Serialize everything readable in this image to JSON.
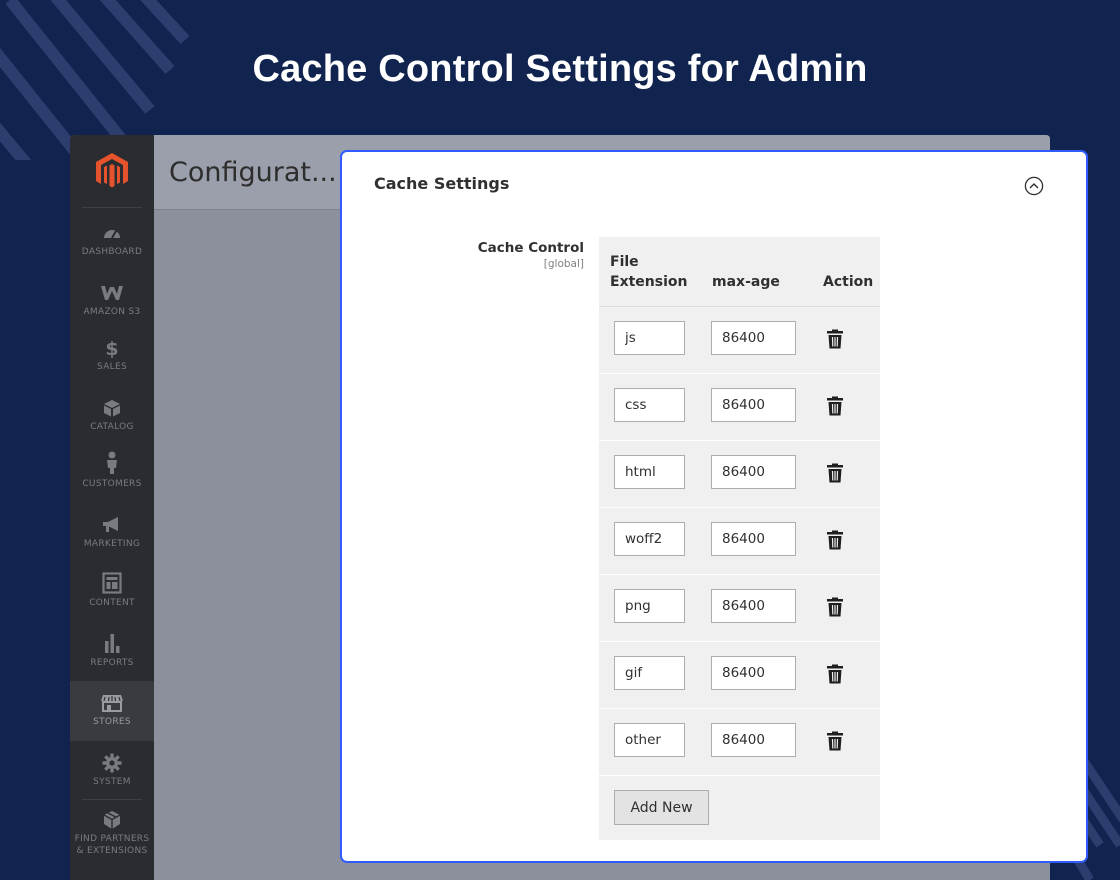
{
  "hero": {
    "title": "Cache Control Settings for Admin"
  },
  "admin": {
    "page_title": "Configurat..."
  },
  "sidebar": {
    "items": [
      {
        "label": "DASHBOARD",
        "icon": "dashboard-icon"
      },
      {
        "label": "AMAZON S3",
        "icon": "amazon-s3-icon"
      },
      {
        "label": "SALES",
        "icon": "dollar-icon"
      },
      {
        "label": "CATALOG",
        "icon": "box-icon"
      },
      {
        "label": "CUSTOMERS",
        "icon": "person-icon"
      },
      {
        "label": "MARKETING",
        "icon": "megaphone-icon"
      },
      {
        "label": "CONTENT",
        "icon": "layout-icon"
      },
      {
        "label": "REPORTS",
        "icon": "bar-chart-icon"
      },
      {
        "label": "STORES",
        "icon": "store-icon"
      },
      {
        "label": "SYSTEM",
        "icon": "gear-icon"
      },
      {
        "label": "FIND PARTNERS",
        "label2": "& EXTENSIONS",
        "icon": "extensions-icon"
      }
    ],
    "active": "STORES"
  },
  "card": {
    "title": "Cache Settings",
    "field": {
      "label": "Cache Control",
      "scope": "[global]"
    },
    "columns": {
      "ext_line1": "File",
      "ext_line2": "Extension",
      "max_age": "max-age",
      "action": "Action"
    },
    "rows": [
      {
        "ext": "js",
        "max_age": "86400"
      },
      {
        "ext": "css",
        "max_age": "86400"
      },
      {
        "ext": "html",
        "max_age": "86400"
      },
      {
        "ext": "woff2",
        "max_age": "86400"
      },
      {
        "ext": "png",
        "max_age": "86400"
      },
      {
        "ext": "gif",
        "max_age": "86400"
      },
      {
        "ext": "other",
        "max_age": "86400"
      }
    ],
    "add_label": "Add New"
  },
  "colors": {
    "background": "#11234f",
    "accent_border": "#2f5bff",
    "magento_orange": "#e5532d"
  }
}
